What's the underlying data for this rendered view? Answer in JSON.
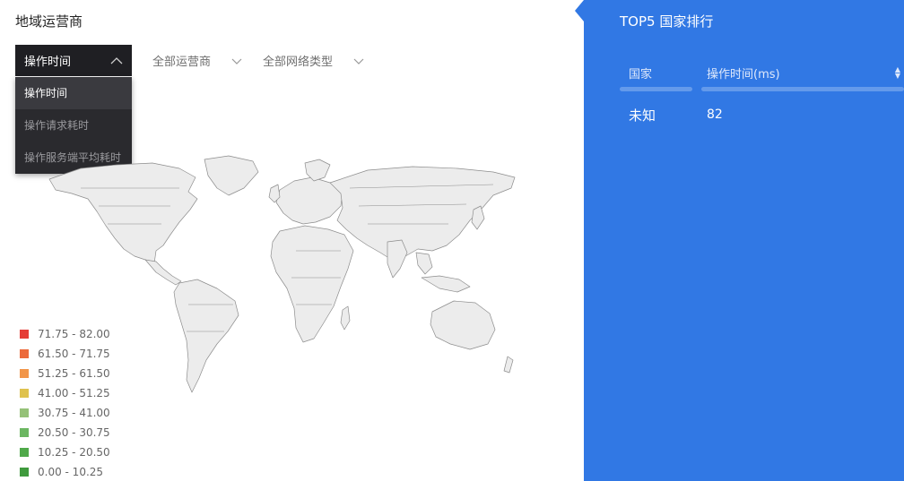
{
  "section_title": "地域运营商",
  "filters": {
    "metric": "操作时间",
    "carrier": "全部运营商",
    "network": "全部网络类型"
  },
  "dropdown": {
    "options": [
      "操作时间",
      "操作请求耗时",
      "操作服务端平均耗时"
    ]
  },
  "legend": [
    {
      "label": "71.75 - 82.00",
      "color": "#e53d36"
    },
    {
      "label": "61.50 - 71.75",
      "color": "#ec6a3b"
    },
    {
      "label": "51.25 - 61.50",
      "color": "#f2964a"
    },
    {
      "label": "41.00 - 51.25",
      "color": "#dfc24e"
    },
    {
      "label": "30.75 - 41.00",
      "color": "#95c178"
    },
    {
      "label": "20.50 - 30.75",
      "color": "#6bb661"
    },
    {
      "label": "10.25 - 20.50",
      "color": "#4fa94a"
    },
    {
      "label": "0.00 - 10.25",
      "color": "#3f9a3d"
    }
  ],
  "ranking": {
    "title": "TOP5 国家排行",
    "columns": [
      "国家",
      "操作时间(ms)"
    ],
    "rows": [
      {
        "country": "未知",
        "value": "82"
      }
    ]
  },
  "colors": {
    "panel": "#3178e4",
    "dropdown": "#1f1f23",
    "map_fill": "#ececec",
    "map_stroke": "#8c8c8c"
  }
}
